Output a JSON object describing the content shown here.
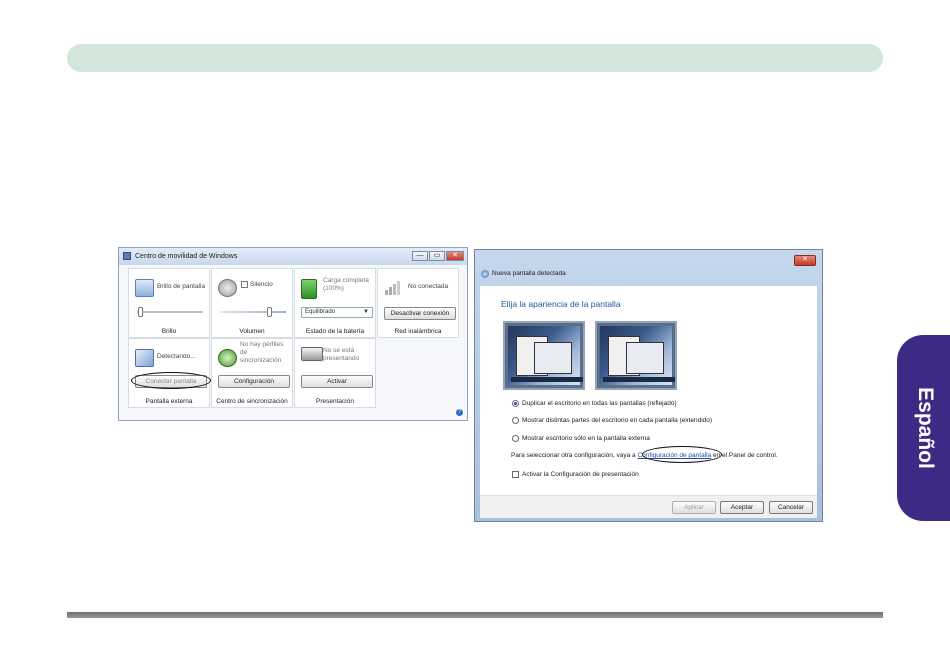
{
  "side_tab": {
    "label": "Español"
  },
  "mobility": {
    "title": "Centro de movilidad de Windows",
    "win_buttons": {
      "minimize": "—",
      "maximize": "▭",
      "close": "✕"
    },
    "tiles": {
      "brillo": {
        "label": "Brillo de pantalla",
        "footer": "Brillo",
        "slider_level": 0.02
      },
      "volumen": {
        "label": "Silencio",
        "footer": "Volumen",
        "slider_level": 0.85
      },
      "bateria": {
        "label": "Carga completa (100%)",
        "select": "Equilibrado",
        "footer": "Estado de la batería"
      },
      "red": {
        "label": "No conectada",
        "button": "Desactivar conexión",
        "footer": "Red inalámbrica"
      },
      "pantalla": {
        "label": "Detectando...",
        "button": "Conectar pantalla",
        "footer": "Pantalla externa"
      },
      "sync": {
        "label": "No hay perfiles de sincronización",
        "button": "Configuración",
        "footer": "Centro de sincronización"
      },
      "presentacion": {
        "label": "No se está presentando",
        "button": "Activar",
        "footer": "Presentación"
      }
    },
    "help": "?"
  },
  "dialog": {
    "title": "Nueva pantalla detectada",
    "close": "✕",
    "heading": "Elija la apariencia de la pantalla",
    "options": [
      {
        "label": "Duplicar el escritorio en todas las pantallas (reflejado)",
        "selected": true
      },
      {
        "label": "Mostrar distintas partes del escritorio en cada pantalla (extendido)",
        "selected": false
      },
      {
        "label": "Mostrar escritorio sólo en la pantalla externa",
        "selected": false
      }
    ],
    "config_pre": "Para seleccionar otra configuración, vaya a ",
    "config_link": "Configuración de pantalla",
    "config_post": " en el Panel de control.",
    "checkbox": "Activar la Configuración de presentación",
    "buttons": {
      "apply": "Aplicar",
      "ok": "Aceptar",
      "cancel": "Cancelar"
    }
  }
}
